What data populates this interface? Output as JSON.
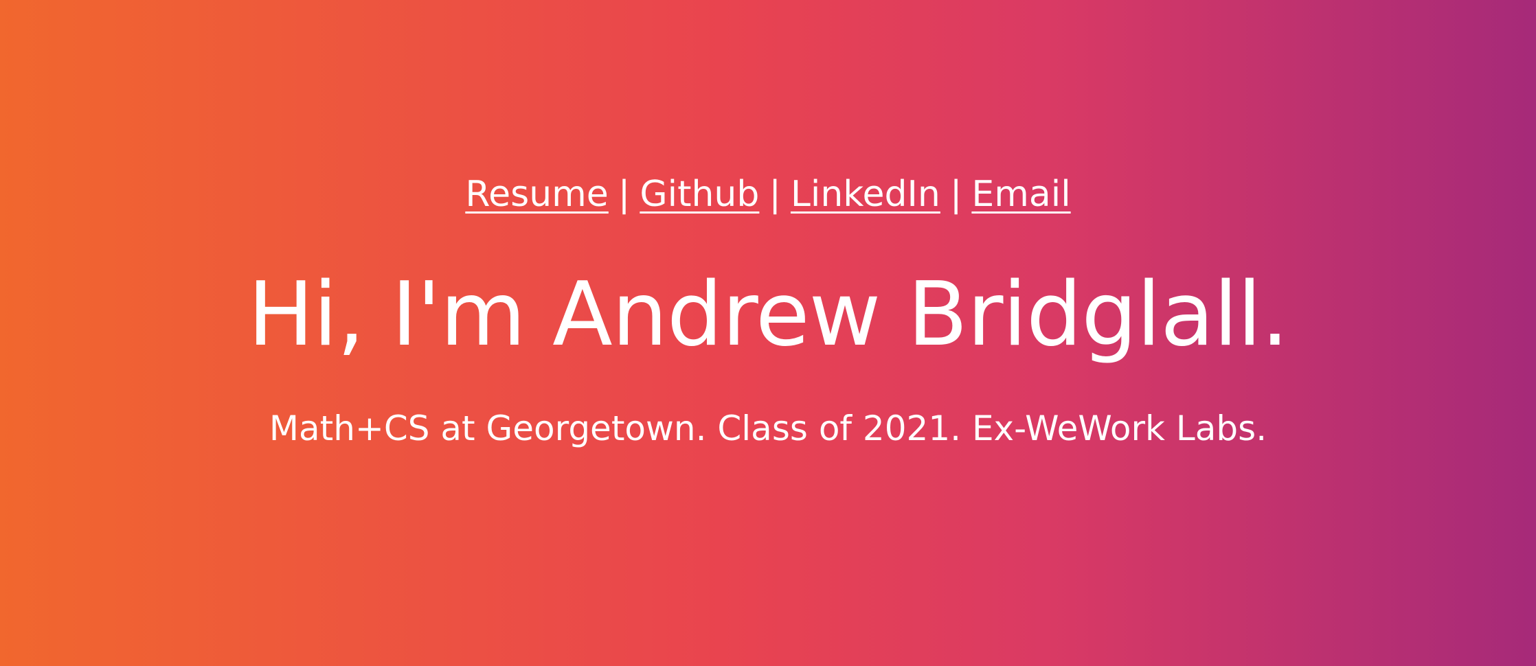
{
  "nav": {
    "links": [
      {
        "label": "Resume"
      },
      {
        "label": "Github"
      },
      {
        "label": "LinkedIn"
      },
      {
        "label": "Email"
      }
    ],
    "separator": "|"
  },
  "hero": {
    "title": "Hi, I'm Andrew Bridglall.",
    "subtitle": "Math+CS at Georgetown. Class of 2021. Ex-WeWork Labs."
  },
  "colors": {
    "gradient": [
      "#f1672e",
      "#e9444f",
      "#da3a64",
      "#a62a79"
    ],
    "text": "#ffffff"
  }
}
